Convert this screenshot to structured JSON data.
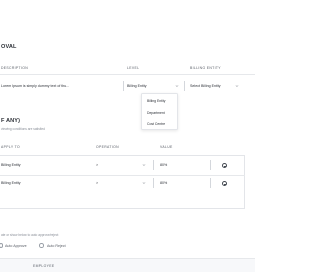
{
  "approval": {
    "title": "OVAL",
    "columns": {
      "description": "DESCRIPTION",
      "level": "LEVEL",
      "billing_entity": "BILLING ENTITY"
    },
    "row": {
      "description": "Lorem Ipsum is simply dummy text of thu...",
      "level": "Billing Entity",
      "billing_entity": "Select Billing Entity"
    },
    "level_menu": [
      "Billing Entity",
      "Department",
      "Cost Centre"
    ]
  },
  "conditions": {
    "title": "F ANY)",
    "subtitle": "viewing conditions are satisfied",
    "columns": {
      "apply_to": "APPLY TO",
      "operation": "OPERATION",
      "value": "VALUE"
    },
    "rows": [
      {
        "apply_to": "Billing Entity",
        "operation": ">",
        "value": "80%"
      },
      {
        "apply_to": "Billing Entity",
        "operation": ">",
        "value": "80%"
      }
    ]
  },
  "auto_action": {
    "prompt": "ate or show below to auto approve/reject",
    "options": [
      "Auto Approve",
      "Auto Reject"
    ]
  },
  "employee_table": {
    "column": "EMPLOYEE"
  }
}
